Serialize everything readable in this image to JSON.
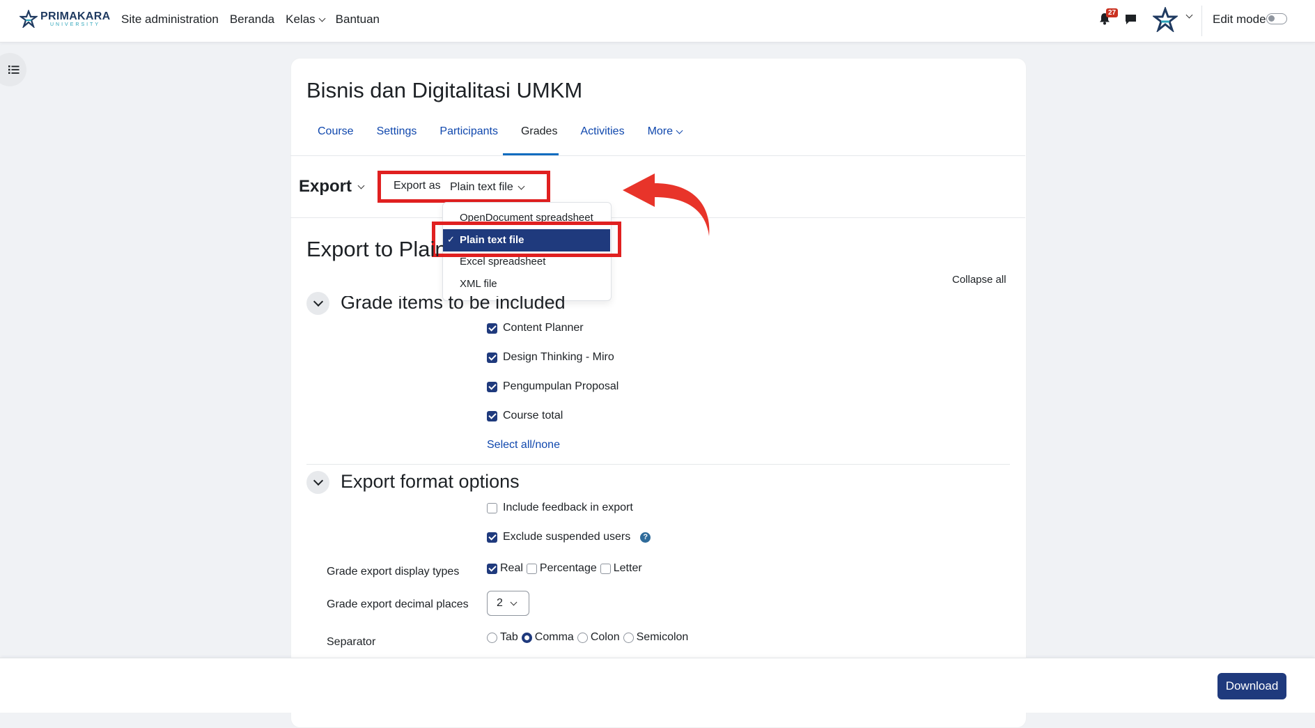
{
  "header": {
    "logo_main": "PRIMAKARA",
    "logo_sub": "UNIVERSITY",
    "nav": [
      "Site administration",
      "Beranda",
      "Kelas",
      "Bantuan"
    ],
    "notification_count": "27",
    "edit_mode_label": "Edit mode"
  },
  "course": {
    "title": "Bisnis dan Digitalitasi UMKM",
    "tabs": [
      "Course",
      "Settings",
      "Participants",
      "Grades",
      "Activities",
      "More"
    ]
  },
  "export": {
    "heading": "Export",
    "export_as_label": "Export as",
    "export_as_value": "Plain text file",
    "options": [
      "OpenDocument spreadsheet",
      "Plain text file",
      "Excel spreadsheet",
      "XML file"
    ],
    "page_title": "Export to Plain text file",
    "collapse_all": "Collapse all"
  },
  "grade_items": {
    "title": "Grade items to be included",
    "items": [
      "Content Planner",
      "Design Thinking - Miro",
      "Pengumpulan Proposal",
      "Course total"
    ],
    "select_all": "Select all/none"
  },
  "format_options": {
    "title": "Export format options",
    "include_feedback": "Include feedback in export",
    "exclude_suspended": "Exclude suspended users",
    "display_types_label": "Grade export display types",
    "display_types": [
      "Real",
      "Percentage",
      "Letter"
    ],
    "decimal_label": "Grade export decimal places",
    "decimal_value": "2",
    "separator_label": "Separator",
    "separators": [
      "Tab",
      "Comma",
      "Colon",
      "Semicolon"
    ]
  },
  "footer": {
    "download_label": "Download"
  }
}
